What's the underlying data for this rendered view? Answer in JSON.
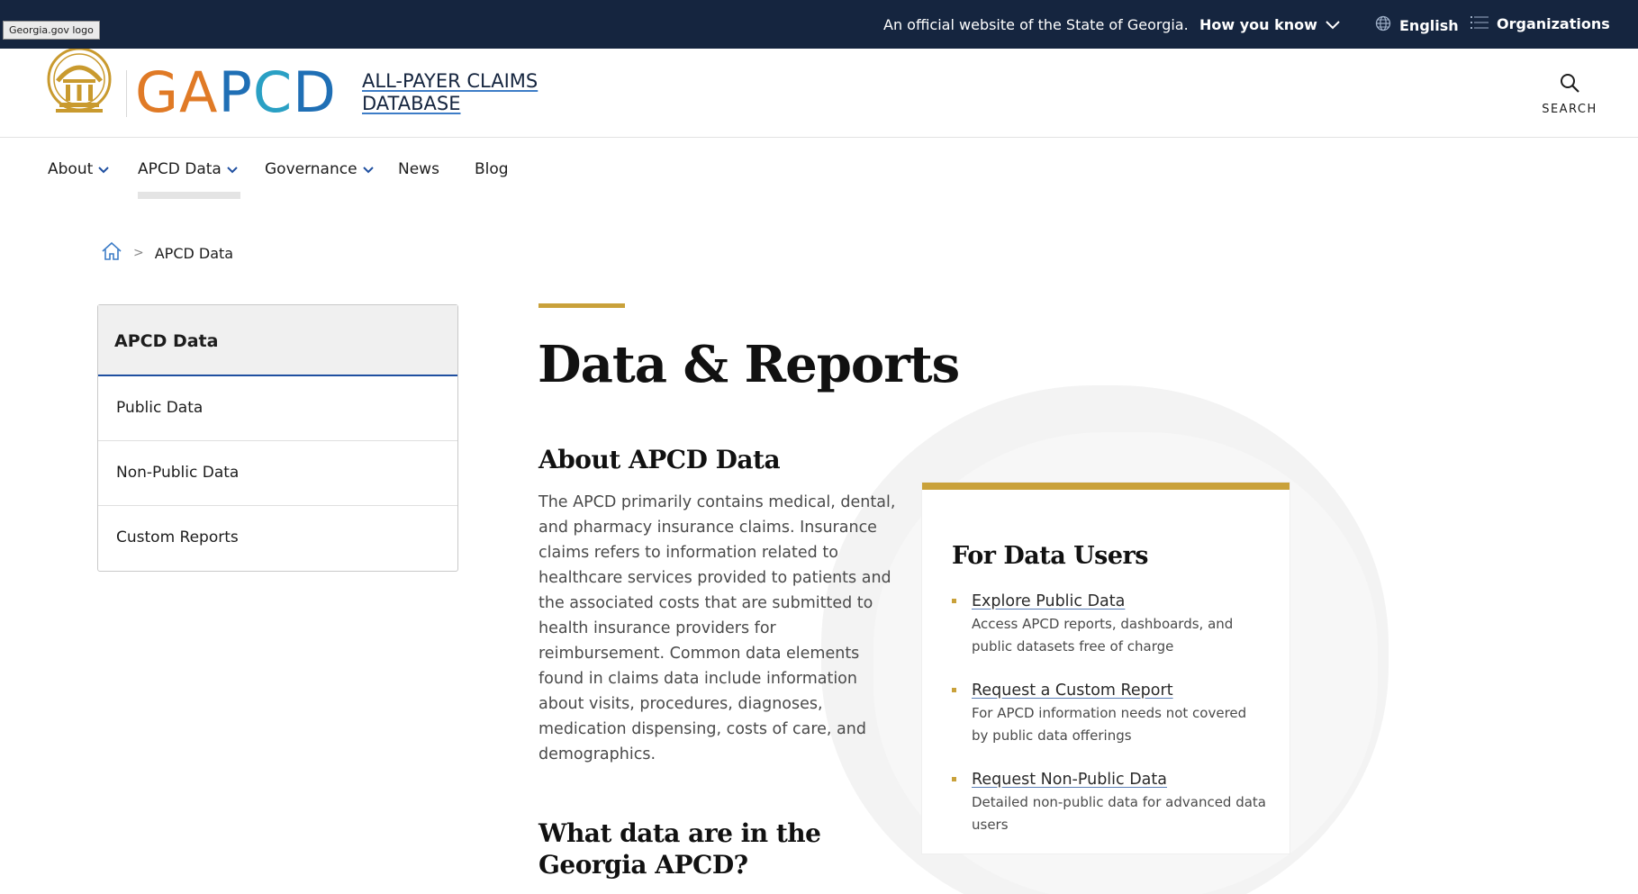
{
  "topbar": {
    "tooltip": "Georgia.gov logo",
    "official_text": "An official website of the State of Georgia.",
    "how_you_know": "How you know",
    "language": "English",
    "organizations": "Organizations"
  },
  "header": {
    "brand_letters": [
      "G",
      "A",
      "P",
      "C",
      "D"
    ],
    "title_line1": "ALL-PAYER CLAIMS",
    "title_line2": "DATABASE",
    "search_label": "SEARCH"
  },
  "nav": {
    "items": [
      {
        "label": "About",
        "has_dropdown": true
      },
      {
        "label": "APCD Data",
        "has_dropdown": true
      },
      {
        "label": "Governance",
        "has_dropdown": true
      },
      {
        "label": "News",
        "has_dropdown": false
      },
      {
        "label": "Blog",
        "has_dropdown": false
      }
    ]
  },
  "breadcrumb": {
    "separator": ">",
    "current": "APCD Data"
  },
  "sidenav": {
    "heading": "APCD Data",
    "items": [
      "Public Data",
      "Non-Public Data",
      "Custom Reports"
    ]
  },
  "main": {
    "title": "Data & Reports",
    "about_heading": "About APCD Data",
    "about_body": "The APCD primarily contains medical, dental, and pharmacy insurance claims. Insurance claims refers to information related to healthcare services provided to patients and the associated costs that are submitted to health insurance providers for reimbursement. Common data elements found in claims data include information about visits, procedures, diagnoses, medication dispensing, costs of care, and demographics.",
    "what_heading": "What data are in the Georgia APCD?"
  },
  "card": {
    "title": "For Data Users",
    "links": [
      {
        "label": "Explore Public Data",
        "description": "Access APCD reports, dashboards, and public datasets free of charge"
      },
      {
        "label": "Request a Custom Report",
        "description": "For APCD information needs not covered by public data offerings"
      },
      {
        "label": "Request Non-Public Data",
        "description": "Detailed non-public data for advanced data users"
      }
    ]
  },
  "colors": {
    "topbar_bg": "#15253f",
    "gold_accent": "#c9a13a",
    "brand_orange": "#e07a26",
    "brand_blue": "#1f6fb5",
    "active_border": "#1f4fa0"
  }
}
